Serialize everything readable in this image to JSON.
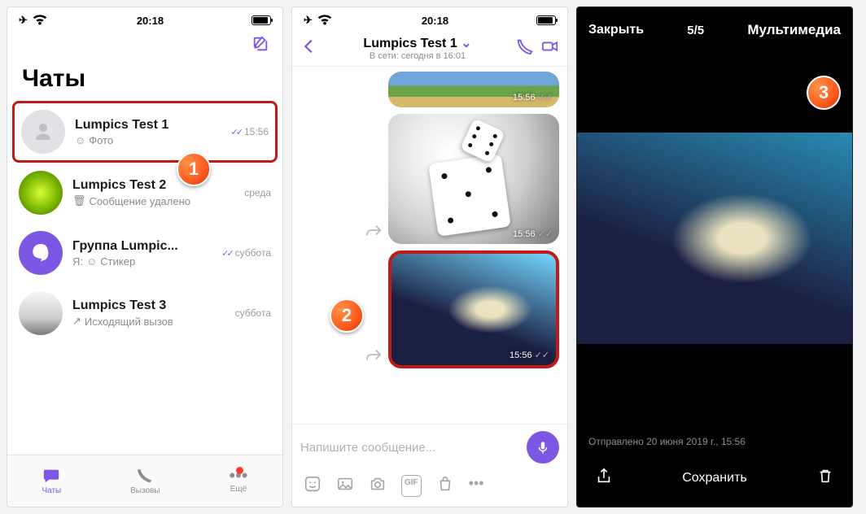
{
  "status_time": "20:18",
  "screen1": {
    "title": "Чаты",
    "chats": [
      {
        "name": "Lumpics Test 1",
        "preview": "Фото",
        "time": "15:56"
      },
      {
        "name": "Lumpics Test 2",
        "preview": "Сообщение удалено",
        "time": "среда"
      },
      {
        "name": "Группа Lumpic...",
        "preview_prefix": "Я:",
        "preview": "Стикер",
        "time": "суббота"
      },
      {
        "name": "Lumpics Test 3",
        "preview": "Исходящий вызов",
        "time": "суббота"
      }
    ],
    "tabs": {
      "chats": "Чаты",
      "calls": "Вызовы",
      "more": "Ещё"
    }
  },
  "screen2": {
    "title": "Lumpics Test 1",
    "subtitle": "В сети: сегодня в 16:01",
    "msg_time": "15:56",
    "input_placeholder": "Напишите сообщение..."
  },
  "screen3": {
    "close": "Закрыть",
    "counter": "5/5",
    "heading": "Мультимедиа",
    "caption": "Отправлено 20 июня 2019 г., 15:56",
    "save": "Сохранить"
  },
  "badges": {
    "b1": "1",
    "b2": "2",
    "b3": "3"
  }
}
